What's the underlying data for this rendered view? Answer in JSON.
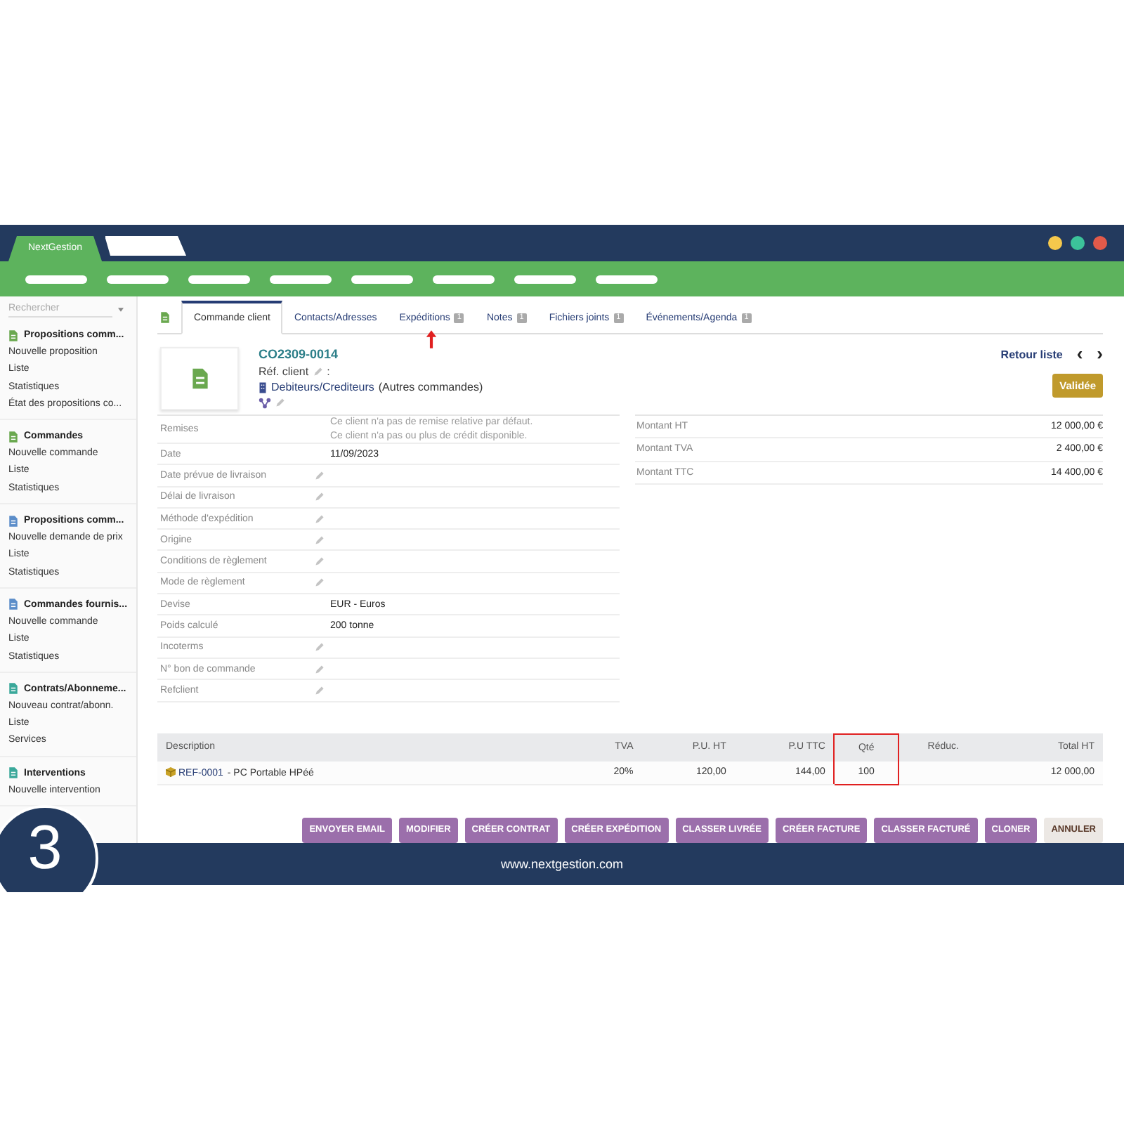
{
  "app_tab": {
    "label": "NextGestion"
  },
  "sidebar": {
    "search": {
      "placeholder": "Rechercher"
    },
    "sections": [
      {
        "title": "Propositions comm...",
        "color": "#6aa84f",
        "items": [
          "Nouvelle proposition",
          "Liste",
          "Statistiques",
          "État des propositions co..."
        ]
      },
      {
        "title": "Commandes",
        "color": "#6aa84f",
        "items": [
          "Nouvelle commande",
          "Liste",
          "Statistiques"
        ]
      },
      {
        "title": "Propositions comm...",
        "color": "#5b8dc9",
        "items": [
          "Nouvelle demande de prix",
          "Liste",
          "Statistiques"
        ]
      },
      {
        "title": "Commandes fournis...",
        "color": "#5b8dc9",
        "items": [
          "Nouvelle commande",
          "Liste",
          "Statistiques"
        ]
      },
      {
        "title": "Contrats/Abonneme...",
        "color": "#3aa89a",
        "items": [
          "Nouveau contrat/abonn.",
          "Liste",
          "Services"
        ]
      },
      {
        "title": "Interventions",
        "color": "#3aa89a",
        "items": [
          "Nouvelle intervention"
        ]
      }
    ]
  },
  "tabs": [
    {
      "label": "Commande client",
      "selected": true,
      "pointer": false
    },
    {
      "label": "Contacts/Adresses",
      "selected": false,
      "pointer": false
    },
    {
      "label": "Expéditions",
      "count": "1",
      "selected": false,
      "pointer": true
    },
    {
      "label": "Notes",
      "count": "1",
      "selected": false,
      "pointer": false
    },
    {
      "label": "Fichiers joints",
      "count": "1",
      "selected": false,
      "pointer": false
    },
    {
      "label": "Événements/Agenda",
      "count": "1",
      "selected": false,
      "pointer": false
    }
  ],
  "order": {
    "ref": "CO2309-0014",
    "ref_client_label": "Réf. client",
    "ref_client_sep": ":",
    "thirdparty": "Debiteurs/Crediteurs",
    "thirdparty_note": "(Autres commandes)",
    "back_link": "Retour liste",
    "prev": "‹",
    "next": "›",
    "status": "Validée"
  },
  "fields": [
    {
      "label": "Remises",
      "notes": [
        "Ce client n'a pas de remise relative par défaut.",
        "Ce client n'a pas ou plus de crédit disponible."
      ],
      "editable": false
    },
    {
      "label": "Date",
      "value": "11/09/2023",
      "editable": false
    },
    {
      "label": "Date prévue de livraison",
      "editable": true
    },
    {
      "label": "Délai de livraison",
      "editable": true
    },
    {
      "label": "Méthode d'expédition",
      "editable": true
    },
    {
      "label": "Origine",
      "editable": true
    },
    {
      "label": "Conditions de règlement",
      "editable": true
    },
    {
      "label": "Mode de règlement",
      "editable": true
    },
    {
      "label": "Devise",
      "value": "EUR - Euros",
      "editable": false
    },
    {
      "label": "Poids calculé",
      "value": "200 tonne",
      "editable": false
    },
    {
      "label": "Incoterms",
      "editable": true
    },
    {
      "label": "N° bon de commande",
      "editable": true
    },
    {
      "label": "Refclient",
      "editable": true
    }
  ],
  "totals": [
    {
      "label": "Montant HT",
      "value": "12 000,00 €"
    },
    {
      "label": "Montant TVA",
      "value": "2 400,00 €"
    },
    {
      "label": "Montant TTC",
      "value": "14 400,00 €"
    }
  ],
  "lines": {
    "columns": [
      {
        "label": "Description",
        "highlighted": false
      },
      {
        "label": "TVA",
        "highlighted": false
      },
      {
        "label": "P.U. HT",
        "highlighted": false
      },
      {
        "label": "P.U TTC",
        "highlighted": false
      },
      {
        "label": "Qté",
        "highlighted": true
      },
      {
        "label": "Réduc.",
        "highlighted": false
      },
      {
        "label": "Total HT",
        "highlighted": false
      }
    ],
    "rows": [
      {
        "ref": "REF-0001",
        "cells": [
          "- PC Portable HPéé",
          "20%",
          "120,00",
          "144,00",
          "100",
          "",
          "12 000,00"
        ]
      }
    ]
  },
  "buttons": [
    {
      "label": "ENVOYER EMAIL",
      "kind": "primary"
    },
    {
      "label": "MODIFIER",
      "kind": "primary"
    },
    {
      "label": "CRÉER CONTRAT",
      "kind": "primary"
    },
    {
      "label": "CRÉER EXPÉDITION",
      "kind": "primary"
    },
    {
      "label": "CLASSER LIVRÉE",
      "kind": "primary"
    },
    {
      "label": "CRÉER FACTURE",
      "kind": "primary"
    },
    {
      "label": "CLASSER FACTURÉ",
      "kind": "primary"
    },
    {
      "label": "CLONER",
      "kind": "primary"
    },
    {
      "label": "ANNULER",
      "kind": "secondary"
    }
  ],
  "footer": {
    "url": "www.nextgestion.com"
  },
  "step": {
    "number": "3"
  }
}
